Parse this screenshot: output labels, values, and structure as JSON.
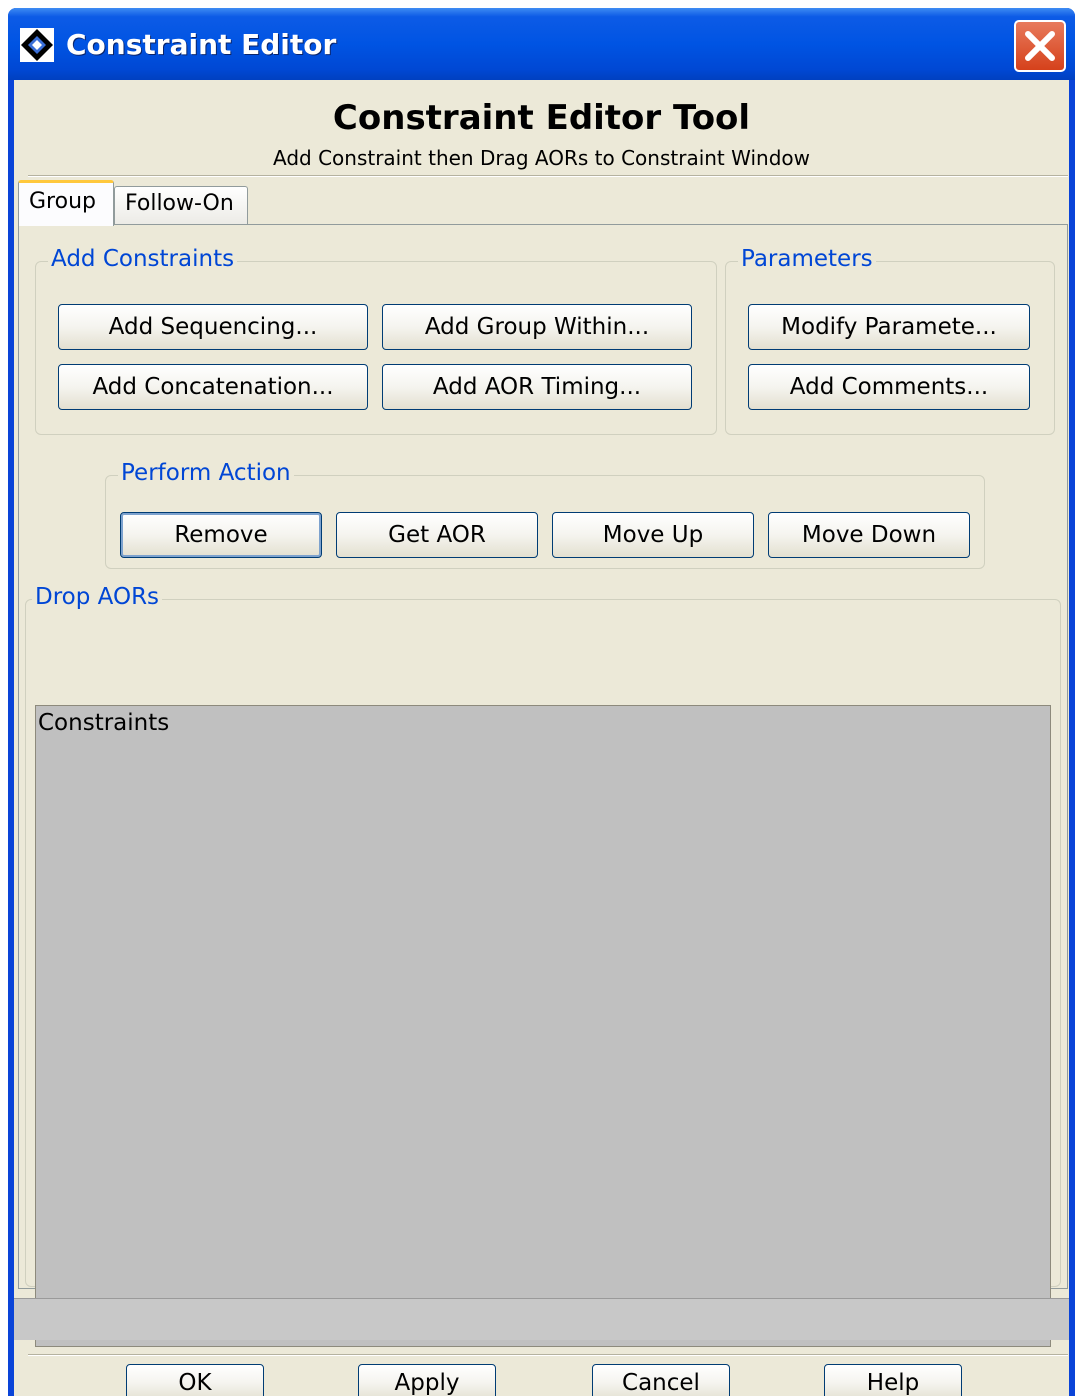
{
  "window": {
    "title": "Constraint Editor"
  },
  "header": {
    "title": "Constraint Editor Tool",
    "subtitle": "Add Constraint then Drag AORs to Constraint Window"
  },
  "tabs": [
    {
      "label": "Group",
      "selected": true
    },
    {
      "label": "Follow-On",
      "selected": false
    }
  ],
  "add_constraints": {
    "label": "Add Constraints",
    "buttons": {
      "sequencing": "Add Sequencing...",
      "group_within": "Add Group Within...",
      "concatenation": "Add Concatenation...",
      "aor_timing": "Add AOR Timing..."
    }
  },
  "parameters": {
    "label": "Parameters",
    "buttons": {
      "modify": "Modify Paramete...",
      "comments": "Add Comments..."
    }
  },
  "perform_action": {
    "label": "Perform Action",
    "buttons": {
      "remove": "Remove",
      "get_aor": "Get AOR",
      "move_up": "Move Up",
      "move_down": "Move Down"
    }
  },
  "drop_aors": {
    "label": "Drop AORs",
    "list_header": "Constraints"
  },
  "footer": {
    "ok": "OK",
    "apply": "Apply",
    "cancel": "Cancel",
    "help": "Help"
  },
  "colors": {
    "titlebar": "#0054e3",
    "group_label": "#0046d5",
    "client_bg": "#ece9d8",
    "drop_area": "#c0c0c0",
    "close_button": "#d5411b"
  }
}
